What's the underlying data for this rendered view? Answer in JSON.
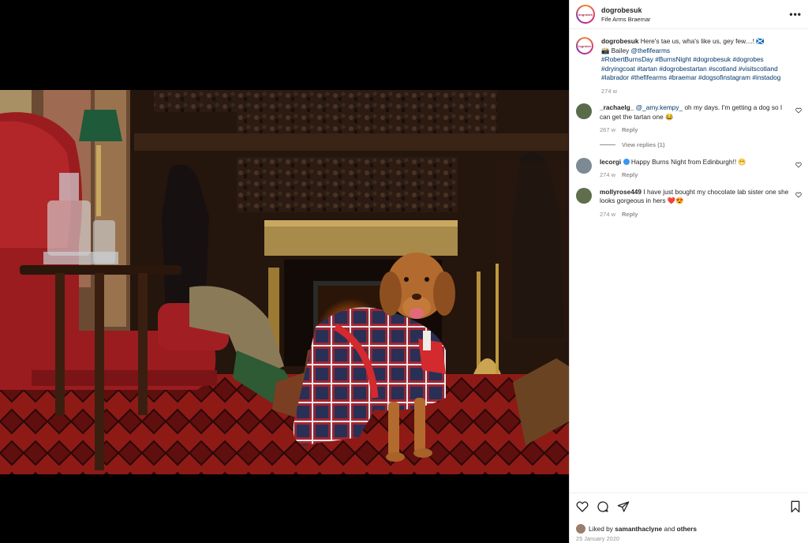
{
  "post": {
    "username": "dogrobesuk",
    "location": "Fife Arms Braemar",
    "avatar_text": "dogrobes",
    "more_label": "•••",
    "photo_alt": "Dog in tartan coat by fireplace"
  },
  "caption": {
    "username": "dogrobesuk",
    "text1": "Here's tae us, wha's like us, gey few....! 🏴󠁧󠁢󠁳󠁣󠁴󠁿",
    "text2": "📸 Bailey",
    "mention": "@thefifearms",
    "hashtags": "#RobertBurnsDay #BurnsNight #dogrobesuk #dogrobes #dryingcoat #tartan #dogrobestartan #scotland #visitscotland #labrador #thefifearms #braemar #dogsofinstagram #instadog",
    "time": "274 w"
  },
  "comments": [
    {
      "username": "_rachaelg_",
      "mention": "@_amy.kempy_",
      "text": "oh my days. I'm getting a dog so I can get the tartan one 😂",
      "time": "267 w",
      "reply": "Reply",
      "avatar_color": "#5a6b4a"
    },
    {
      "username": "lecorgi",
      "text": "Happy Burns Night from Edinburgh!! 😁",
      "time": "274 w",
      "reply": "Reply",
      "avatar_color": "#7d8a93"
    },
    {
      "username": "mollyrose449",
      "text": "I have just bought my chocolate lab sister one she looks gorgeous in hers ❤️😍",
      "time": "274 w",
      "reply": "Reply",
      "avatar_color": "#5f6e4d"
    }
  ],
  "view_replies": "View replies (1)",
  "likes": {
    "prefix": "Liked by",
    "user": "samanthaclyne",
    "and": "and",
    "others": "others"
  },
  "date": "25 January 2020"
}
